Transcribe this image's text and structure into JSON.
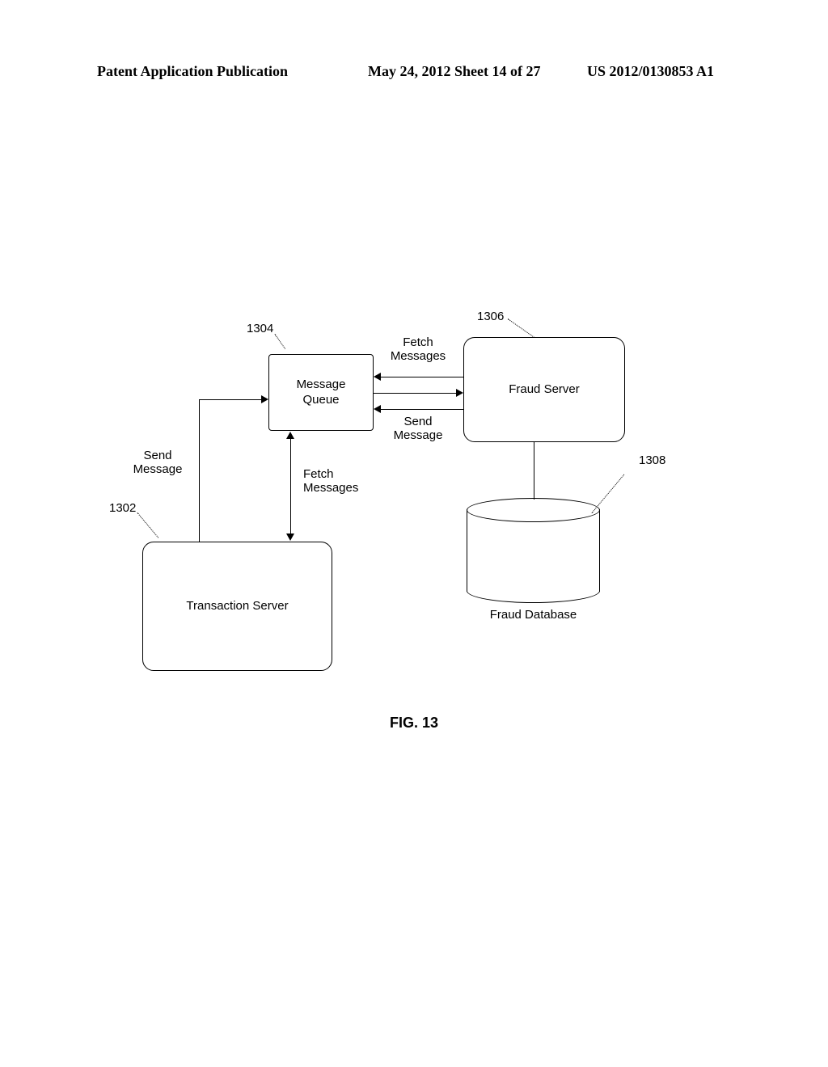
{
  "header": {
    "left": "Patent Application Publication",
    "mid": "May 24, 2012  Sheet 14 of 27",
    "right": "US 2012/0130853 A1"
  },
  "figure_label": "FIG. 13",
  "nodes": {
    "message_queue": "Message\nQueue",
    "fraud_server": "Fraud Server",
    "transaction_server": "Transaction Server",
    "fraud_database": "Fraud Database"
  },
  "edge_labels": {
    "mq_fs_fetch": "Fetch\nMessages",
    "mq_fs_send": "Send\nMessage",
    "ts_mq_send": "Send\nMessage",
    "ts_mq_fetch": "Fetch\nMessages"
  },
  "refs": {
    "transaction_server": "1302",
    "message_queue": "1304",
    "fraud_server": "1306",
    "fraud_database": "1308"
  }
}
